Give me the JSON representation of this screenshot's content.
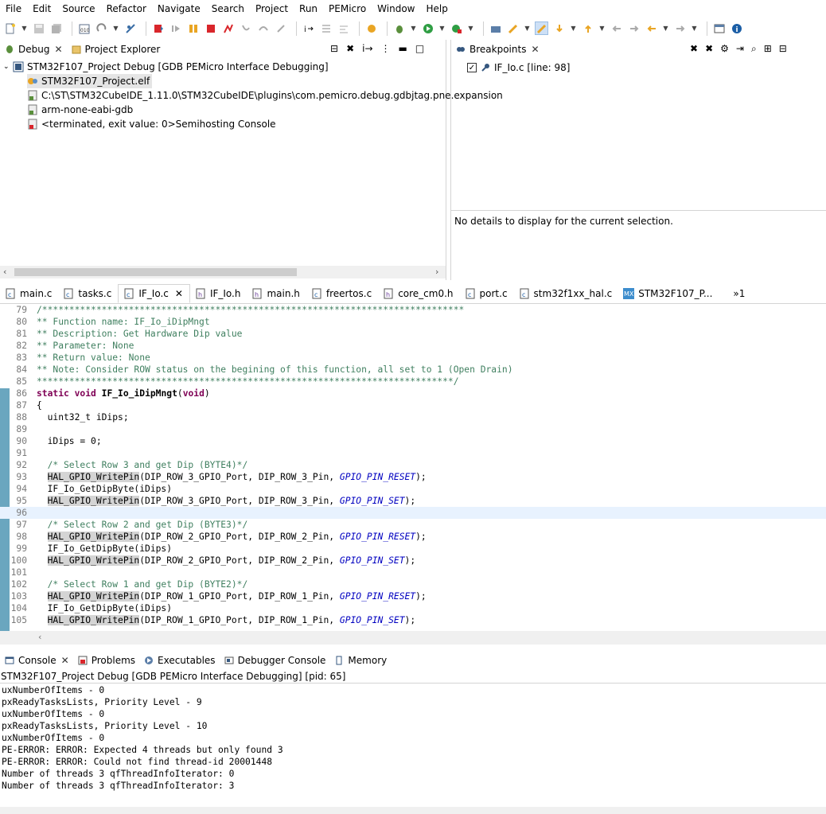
{
  "menu": [
    "File",
    "Edit",
    "Source",
    "Refactor",
    "Navigate",
    "Search",
    "Project",
    "Run",
    "PEMicro",
    "Window",
    "Help"
  ],
  "debug_panel": {
    "tabs": [
      {
        "label": "Debug",
        "closable": true
      },
      {
        "label": "Project Explorer",
        "closable": false
      }
    ],
    "tree": [
      "STM32F107_Project Debug [GDB PEMicro Interface Debugging]",
      "STM32F107_Project.elf",
      "C:\\ST\\STM32CubeIDE_1.11.0\\STM32CubeIDE\\plugins\\com.pemicro.debug.gdbjtag.pne.expansion",
      "arm-none-eabi-gdb",
      "<terminated, exit value: 0>Semihosting Console"
    ]
  },
  "breakpoints_panel": {
    "tab_label": "Breakpoints",
    "items": [
      {
        "label": "IF_Io.c [line: 98]",
        "checked": true
      }
    ],
    "details": "No details to display for the current selection."
  },
  "editor_tabs": [
    {
      "label": "main.c",
      "selected": false
    },
    {
      "label": "tasks.c",
      "selected": false
    },
    {
      "label": "IF_Io.c",
      "selected": true
    },
    {
      "label": "IF_Io.h",
      "selected": false
    },
    {
      "label": "main.h",
      "selected": false
    },
    {
      "label": "freertos.c",
      "selected": false
    },
    {
      "label": "core_cm0.h",
      "selected": false
    },
    {
      "label": "port.c",
      "selected": false
    },
    {
      "label": "stm32f1xx_hal.c",
      "selected": false
    },
    {
      "label": "STM32F107_P...",
      "selected": false
    }
  ],
  "editor_overflow": "»1",
  "code_lines": [
    {
      "n": "79",
      "t": "/******************************************************************************"
    },
    {
      "n": "80",
      "t": "** Function name: IF_Io_iDipMngt"
    },
    {
      "n": "81",
      "t": "** Description: Get Hardware Dip value"
    },
    {
      "n": "82",
      "t": "** Parameter: None"
    },
    {
      "n": "83",
      "t": "** Return value: None"
    },
    {
      "n": "84",
      "t": "** Note: Consider ROW status on the begining of this function, all set to 1 (Open Drain)"
    },
    {
      "n": "85",
      "t": "*****************************************************************************/"
    },
    {
      "n": "86",
      "t": "static void IF_Io_iDipMngt(void)"
    },
    {
      "n": "87",
      "t": "{"
    },
    {
      "n": "88",
      "t": "  uint32_t iDips;"
    },
    {
      "n": "89",
      "t": ""
    },
    {
      "n": "90",
      "t": "  iDips = 0;"
    },
    {
      "n": "91",
      "t": ""
    },
    {
      "n": "92",
      "t": "  /* Select Row 3 and get Dip (BYTE4)*/"
    },
    {
      "n": "93",
      "t": "  HAL_GPIO_WritePin(DIP_ROW_3_GPIO_Port, DIP_ROW_3_Pin, GPIO_PIN_RESET);"
    },
    {
      "n": "94",
      "t": "  IF_Io_GetDipByte(iDips)"
    },
    {
      "n": "95",
      "t": "  HAL_GPIO_WritePin(DIP_ROW_3_GPIO_Port, DIP_ROW_3_Pin, GPIO_PIN_SET);"
    },
    {
      "n": "96",
      "t": ""
    },
    {
      "n": "97",
      "t": "  /* Select Row 2 and get Dip (BYTE3)*/"
    },
    {
      "n": "98",
      "t": "  HAL_GPIO_WritePin(DIP_ROW_2_GPIO_Port, DIP_ROW_2_Pin, GPIO_PIN_RESET);"
    },
    {
      "n": "99",
      "t": "  IF_Io_GetDipByte(iDips)"
    },
    {
      "n": "100",
      "t": "  HAL_GPIO_WritePin(DIP_ROW_2_GPIO_Port, DIP_ROW_2_Pin, GPIO_PIN_SET);"
    },
    {
      "n": "101",
      "t": ""
    },
    {
      "n": "102",
      "t": "  /* Select Row 1 and get Dip (BYTE2)*/"
    },
    {
      "n": "103",
      "t": "  HAL_GPIO_WritePin(DIP_ROW_1_GPIO_Port, DIP_ROW_1_Pin, GPIO_PIN_RESET);"
    },
    {
      "n": "104",
      "t": "  IF_Io_GetDipByte(iDips)"
    },
    {
      "n": "105",
      "t": "  HAL_GPIO_WritePin(DIP_ROW_1_GPIO_Port, DIP_ROW_1_Pin, GPIO_PIN_SET);"
    }
  ],
  "console": {
    "tabs": [
      {
        "label": "Console",
        "closable": true
      },
      {
        "label": "Problems",
        "closable": false
      },
      {
        "label": "Executables",
        "closable": false
      },
      {
        "label": "Debugger Console",
        "closable": false
      },
      {
        "label": "Memory",
        "closable": false
      }
    ],
    "title": "STM32F107_Project Debug [GDB PEMicro Interface Debugging]  [pid: 65]",
    "lines": [
      "uxNumberOfItems - 0",
      "pxReadyTasksLists, Priority Level - 9",
      "uxNumberOfItems - 0",
      "pxReadyTasksLists, Priority Level - 10",
      "uxNumberOfItems - 0",
      "PE-ERROR: ERROR: Expected 4 threads but only found 3",
      "PE-ERROR: ERROR: Could not find thread-id 20001448",
      "Number of threads 3 qfThreadInfoIterator: 0",
      "Number of threads 3 qfThreadInfoIterator: 3"
    ]
  }
}
